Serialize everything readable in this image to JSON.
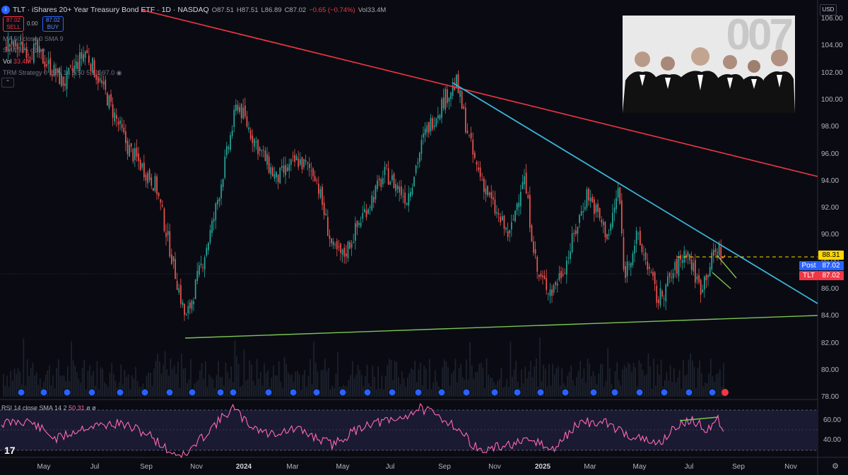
{
  "header": {
    "title": "TLT · iShares 20+ Year Treasury Bond ETF · 1D · NASDAQ",
    "ohlc": {
      "open": "O87.51",
      "high": "H87.51",
      "low": "L86.89",
      "close": "C87.02",
      "change": "−0.65 (−0.74%)",
      "volume": "Vol33.4M"
    },
    "sell_price": "87.02",
    "sell_label": "SELL",
    "buy_price": "87.02",
    "buy_label": "BUY",
    "spread": "0.00"
  },
  "indicators": [
    {
      "label": "MA 50 close 0 SMA 9"
    },
    {
      "label": "SMA 325 close"
    },
    {
      "label": "Vol",
      "value": "33.4M"
    },
    {
      "label": "TRM Strategy 0 25 5 14 5 50 5 1 1 97.0"
    }
  ],
  "currency": "USD",
  "price_axis": {
    "ticks": [
      "106.00",
      "104.00",
      "102.00",
      "100.00",
      "98.00",
      "96.00",
      "94.00",
      "92.00",
      "90.00",
      "88.00",
      "86.00",
      "84.00",
      "82.00",
      "80.00",
      "78.00"
    ]
  },
  "price_tags": {
    "level": "88.31",
    "post_label": "Post",
    "post": "87.02",
    "tlt_label": "TLT",
    "tlt": "87.02"
  },
  "time_axis": {
    "labels": [
      "May",
      "Jul",
      "Sep",
      "Nov",
      "2024",
      "Mar",
      "May",
      "Jul",
      "Sep",
      "Nov",
      "2025",
      "Mar",
      "May",
      "Jul",
      "Sep",
      "Nov"
    ]
  },
  "rsi": {
    "label": "RSI 14 close SMA 14 2",
    "value": "50.31",
    "ticks": [
      "60.00",
      "40.00"
    ]
  },
  "photo": {
    "watermark": "007"
  },
  "colors": {
    "bg": "#0a0b12",
    "up": "#26a69a",
    "down": "#ef5350",
    "red_line": "#f23645",
    "blue_line": "#3bb4d8",
    "green_line": "#7cc453",
    "rsi": "#ff69b4",
    "level": "#ffd600"
  },
  "chart_data": {
    "type": "candlestick",
    "symbol": "TLT",
    "ylim": [
      78,
      106
    ],
    "x": [
      "2023-05",
      "2023-07",
      "2023-09",
      "2023-10",
      "2023-11",
      "2024-01",
      "2024-03",
      "2024-04",
      "2024-05",
      "2024-07",
      "2024-09",
      "2024-10",
      "2024-11",
      "2024-12",
      "2025-01",
      "2025-03",
      "2025-04",
      "2025-05",
      "2025-06",
      "2025-07",
      "2025-08"
    ],
    "close": [
      103.5,
      101.0,
      95.0,
      88.0,
      82.5,
      99.5,
      94.0,
      90.0,
      87.5,
      94.5,
      101.0,
      95.0,
      89.5,
      87.0,
      85.0,
      92.5,
      88.5,
      85.0,
      86.0,
      87.5,
      87.02
    ],
    "trendlines": [
      {
        "color": "red",
        "from": [
          "2023-03",
          107
        ],
        "to": [
          "2025-10",
          94.2
        ]
      },
      {
        "color": "blue",
        "from": [
          "2024-09",
          101.4
        ],
        "to": [
          "2025-10",
          84.8
        ]
      },
      {
        "color": "green",
        "from": [
          "2023-10",
          82.4
        ],
        "to": [
          "2025-10",
          84.1
        ]
      }
    ],
    "horizontal_level": 88.31
  }
}
